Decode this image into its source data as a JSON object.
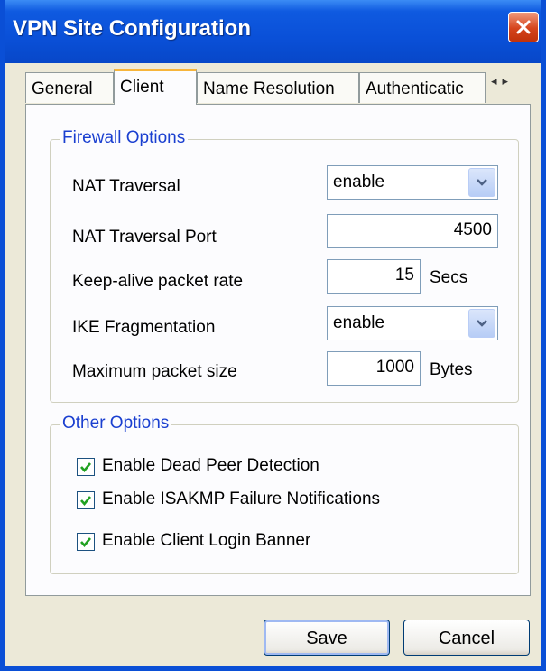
{
  "window": {
    "title": "VPN Site Configuration"
  },
  "tabs": [
    {
      "label": "General"
    },
    {
      "label": "Client"
    },
    {
      "label": "Name Resolution"
    },
    {
      "label": "Authenticatic"
    }
  ],
  "tab_scroll": {
    "left": "◂",
    "right": "▸"
  },
  "firewall": {
    "title": "Firewall Options",
    "nat_traversal": {
      "label": "NAT Traversal",
      "value": "enable"
    },
    "nat_port": {
      "label": "NAT Traversal Port",
      "value": "4500"
    },
    "keepalive": {
      "label": "Keep-alive packet rate",
      "value": "15",
      "unit": "Secs"
    },
    "ike_frag": {
      "label": "IKE Fragmentation",
      "value": "enable"
    },
    "max_packet": {
      "label": "Maximum packet size",
      "value": "1000",
      "unit": "Bytes"
    }
  },
  "other": {
    "title": "Other Options",
    "options": [
      {
        "label": "Enable Dead Peer Detection",
        "checked": true
      },
      {
        "label": "Enable ISAKMP Failure Notifications",
        "checked": true
      },
      {
        "label": "Enable Client Login Banner",
        "checked": true
      }
    ]
  },
  "buttons": {
    "save": "Save",
    "cancel": "Cancel"
  },
  "colors": {
    "titlebar": "#0a50d8",
    "group_title": "#1a3fd0",
    "check": "#21a121",
    "active_tab_accent": "#f7b53b"
  }
}
